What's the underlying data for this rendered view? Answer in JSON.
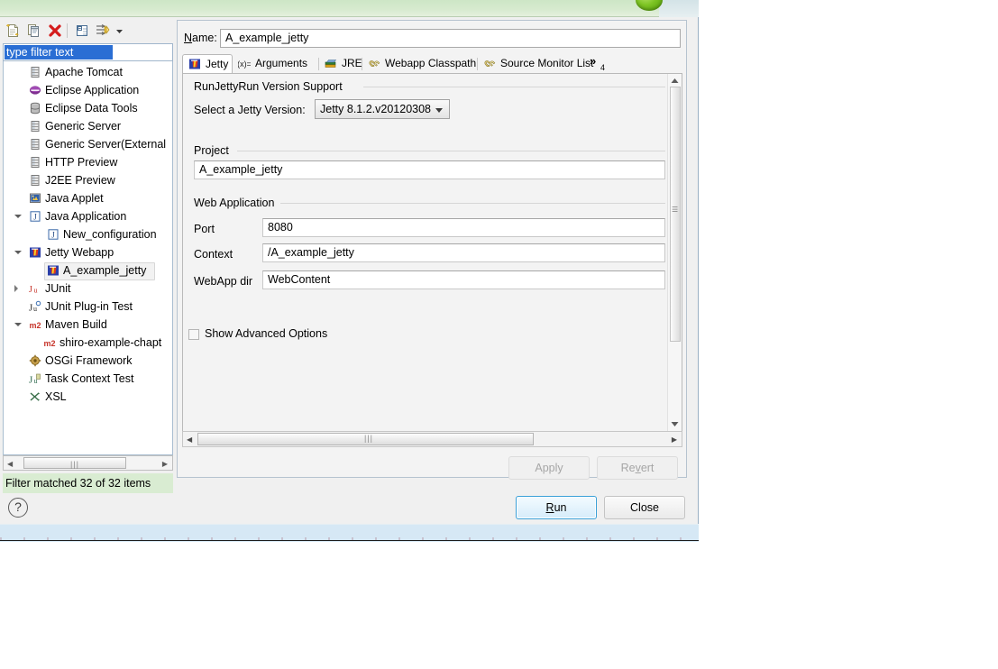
{
  "dialog": {
    "title_bar_visible": false,
    "accent_green": "#4e9a06",
    "status_bg": "#d9ecd2"
  },
  "toolbar": {
    "buttons": [
      {
        "name": "new-launch-configuration",
        "icon": "new-document-icon"
      },
      {
        "name": "duplicate-launch-configuration",
        "icon": "copy-icon"
      },
      {
        "name": "delete-launch-configuration",
        "icon": "delete-x-icon"
      },
      {
        "name": "collapse-all",
        "icon": "collapse-all-icon"
      },
      {
        "name": "filter-launch-configurations",
        "icon": "filter-icon"
      },
      {
        "name": "filter-menu",
        "icon": "chevron-down-icon"
      }
    ]
  },
  "filter": {
    "value": "type filter text",
    "placeholder": "type filter text"
  },
  "tree": {
    "items": [
      {
        "label": "Apache Tomcat",
        "indent": 28,
        "icon": "server-icon",
        "expander": "none",
        "selected": false
      },
      {
        "label": "Eclipse Application",
        "indent": 28,
        "icon": "eclipse-icon",
        "expander": "none",
        "selected": false
      },
      {
        "label": "Eclipse Data Tools",
        "indent": 28,
        "icon": "database-icon",
        "expander": "none",
        "selected": false
      },
      {
        "label": "Generic Server",
        "indent": 28,
        "icon": "server-icon",
        "expander": "none",
        "selected": false
      },
      {
        "label": "Generic Server(External",
        "indent": 28,
        "icon": "server-icon",
        "expander": "none",
        "selected": false
      },
      {
        "label": "HTTP Preview",
        "indent": 28,
        "icon": "server-icon",
        "expander": "none",
        "selected": false
      },
      {
        "label": "J2EE Preview",
        "indent": 28,
        "icon": "server-icon",
        "expander": "none",
        "selected": false
      },
      {
        "label": "Java Applet",
        "indent": 28,
        "icon": "java-applet-icon",
        "expander": "none",
        "selected": false
      },
      {
        "label": "Java Application",
        "indent": 28,
        "icon": "java-app-icon",
        "expander": "expanded",
        "selected": false
      },
      {
        "label": "New_configuration",
        "indent": 48,
        "icon": "java-app-icon",
        "expander": "none",
        "selected": false
      },
      {
        "label": "Jetty Webapp",
        "indent": 28,
        "icon": "jetty-icon",
        "expander": "expanded",
        "selected": false
      },
      {
        "label": "A_example_jetty",
        "indent": 48,
        "icon": "jetty-icon",
        "expander": "none",
        "selected": true
      },
      {
        "label": "JUnit",
        "indent": 28,
        "icon": "junit-icon",
        "expander": "collapsed",
        "selected": false
      },
      {
        "label": "JUnit Plug-in Test",
        "indent": 28,
        "icon": "junit-plugin-icon",
        "expander": "none",
        "selected": false
      },
      {
        "label": "Maven Build",
        "indent": 28,
        "icon": "maven-icon",
        "expander": "expanded",
        "selected": false
      },
      {
        "label": "shiro-example-chapt",
        "indent": 44,
        "icon": "maven-icon",
        "expander": "none",
        "selected": false
      },
      {
        "label": "OSGi Framework",
        "indent": 28,
        "icon": "osgi-icon",
        "expander": "none",
        "selected": false
      },
      {
        "label": "Task Context Test",
        "indent": 28,
        "icon": "junit-task-icon",
        "expander": "none",
        "selected": false
      },
      {
        "label": "XSL",
        "indent": 28,
        "icon": "xsl-icon",
        "expander": "none",
        "selected": false
      }
    ]
  },
  "status": {
    "text": "Filter matched 32 of 32 items"
  },
  "help": {
    "glyph": "?"
  },
  "name_field": {
    "label": "Name:",
    "label_mnemonic": "N",
    "value": "A_example_jetty"
  },
  "tabs": {
    "items": [
      {
        "label": "Jetty",
        "icon": "jetty-icon",
        "active": true
      },
      {
        "label": "Arguments",
        "icon": "arguments-icon",
        "active": false
      },
      {
        "label": "JRE",
        "icon": "jre-icon",
        "active": false
      },
      {
        "label": "Webapp Classpath",
        "icon": "classpath-icon",
        "active": false
      },
      {
        "label": "Source Monitor List",
        "icon": "classpath-icon",
        "active": false
      }
    ],
    "overflow": {
      "glyph": "»",
      "count": "4"
    }
  },
  "form": {
    "version_group": {
      "title": "RunJettyRun Version Support",
      "select_label": "Select a Jetty Version:",
      "selected_version": "Jetty 8.1.2.v20120308"
    },
    "project_group": {
      "title": "Project",
      "value": "A_example_jetty"
    },
    "webapp_group": {
      "title": "Web Application",
      "fields": [
        {
          "label": "Port",
          "value": "8080"
        },
        {
          "label": "Context",
          "value": "/A_example_jetty"
        },
        {
          "label": "WebApp dir",
          "value": "WebContent"
        }
      ]
    },
    "advanced": {
      "label": "Show Advanced Options",
      "checked": false
    }
  },
  "buttons": {
    "apply": {
      "label": "Apply",
      "enabled": false
    },
    "revert": {
      "label": "Revert",
      "enabled": false,
      "mnemonic": "v"
    },
    "run": {
      "label": "Run",
      "enabled": true,
      "default": true,
      "mnemonic": "R"
    },
    "close": {
      "label": "Close",
      "enabled": true
    }
  }
}
